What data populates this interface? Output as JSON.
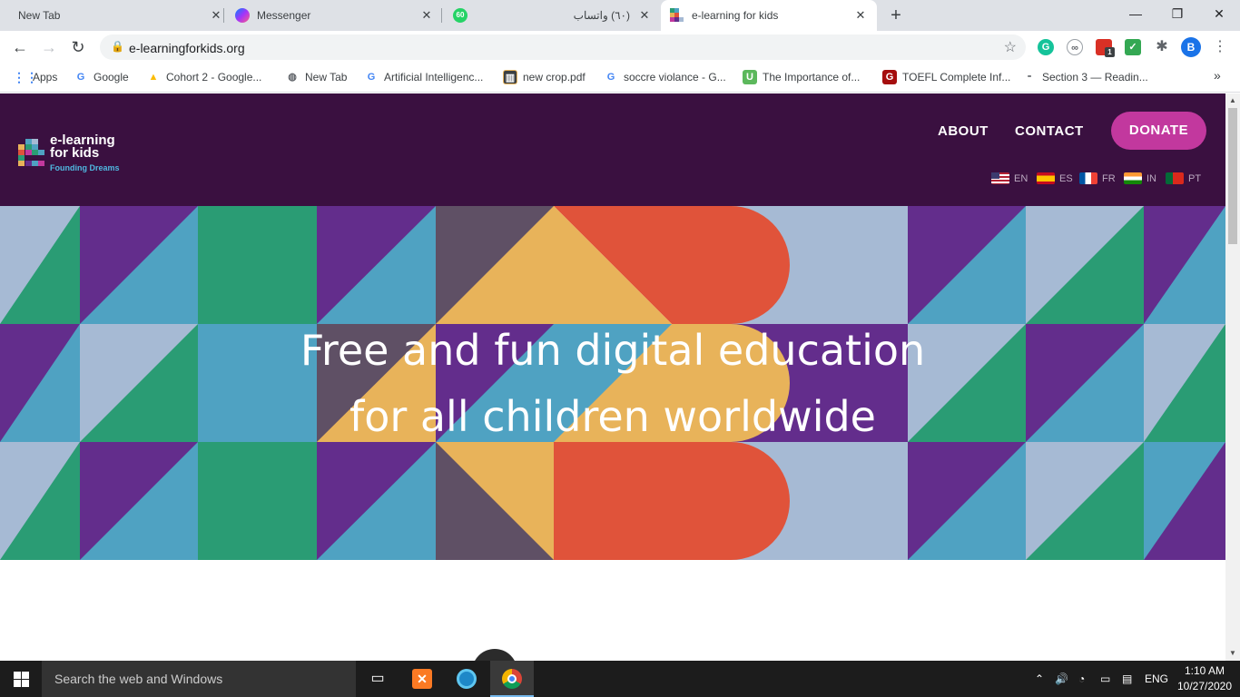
{
  "browser": {
    "tabs": [
      {
        "title": "New Tab",
        "active": false
      },
      {
        "title": "Messenger",
        "active": false
      },
      {
        "title": "(٦٠) واتساب",
        "badge": "60",
        "active": false
      },
      {
        "title": "e-learning for kids",
        "active": true
      }
    ],
    "new_tab": "+",
    "window_controls": {
      "minimize": "—",
      "restore": "❐",
      "close": "✕"
    },
    "url": "e-learningforkids.org",
    "profile_initial": "B",
    "ext_badge": "1",
    "bookmarks": [
      {
        "label": "Apps",
        "icon": "apps-grid-icon"
      },
      {
        "label": "Google",
        "icon": "google-icon"
      },
      {
        "label": "Cohort 2 - Google...",
        "icon": "google-drive-icon"
      },
      {
        "label": "New Tab",
        "icon": "globe-icon"
      },
      {
        "label": "Artificial Intelligenc...",
        "icon": "google-icon"
      },
      {
        "label": "new crop.pdf",
        "icon": "pdf-icon"
      },
      {
        "label": "soccre violance - G...",
        "icon": "google-icon"
      },
      {
        "label": "The Importance of...",
        "icon": "u-icon"
      },
      {
        "label": "TOEFL Complete Inf...",
        "icon": "g-red-icon"
      },
      {
        "label": "Section 3 — Readin...",
        "icon": "dash-icon"
      }
    ],
    "bookmarks_overflow": "»"
  },
  "site": {
    "logo": {
      "line1": "e-learning",
      "line2": "for kids",
      "tagline": "Founding Dreams"
    },
    "nav": {
      "about": "ABOUT",
      "contact": "CONTACT",
      "donate": "DONATE"
    },
    "languages": [
      {
        "code": "EN",
        "flag": "us-flag-icon"
      },
      {
        "code": "ES",
        "flag": "spain-flag-icon"
      },
      {
        "code": "FR",
        "flag": "france-flag-icon"
      },
      {
        "code": "IN",
        "flag": "india-flag-icon"
      },
      {
        "code": "PT",
        "flag": "portugal-flag-icon"
      }
    ],
    "hero": {
      "line1": "Free and fun digital education",
      "line2": "for all children worldwide"
    },
    "colors": {
      "header_bg": "#3a1040",
      "donate": "#c2389e",
      "purple": "#632d8c",
      "blue": "#4fa2c2",
      "green": "#2a9c74",
      "lightblue": "#a6bad4",
      "orange": "#e0533a",
      "yellow": "#e8b35a",
      "slate": "#5f5065"
    }
  },
  "taskbar": {
    "search_placeholder": "Search the web and Windows",
    "language": "ENG",
    "time": "1:10 AM",
    "date": "10/27/2020"
  }
}
